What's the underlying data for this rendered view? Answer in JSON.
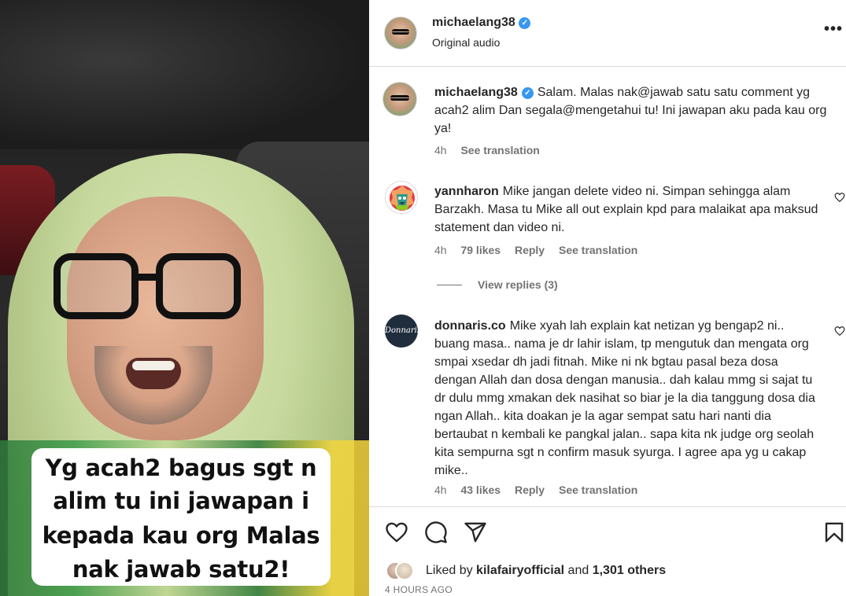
{
  "video": {
    "caption_lines": [
      "Yg acah2 bagus sgt n",
      "alim tu ini jawapan i",
      "kepada kau org Malas",
      "nak jawab satu2!"
    ]
  },
  "header": {
    "username": "michaelang38",
    "subtitle": "Original audio",
    "more_icon": "more-options-icon"
  },
  "caption": {
    "username": "michaelang38",
    "text": "Salam. Malas nak@jawab satu satu comment yg acah2 alim Dan segala@mengetahui tu! Ini jawapan aku pada kau org ya!",
    "time": "4h",
    "see_translation": "See translation"
  },
  "comments": [
    {
      "username": "yannharon",
      "text": "Mike jangan delete video ni. Simpan sehingga alam Barzakh. Masa tu Mike all out explain kpd para malaikat apa maksud statement dan video ni.",
      "time": "4h",
      "likes": "79 likes",
      "reply": "Reply",
      "see_translation": "See translation",
      "view_replies": "View replies (3)"
    },
    {
      "username": "donnaris.co",
      "avatar_text": "Donnaris",
      "text": "Mike xyah lah explain kat netizan yg bengap2 ni.. buang masa.. nama je dr lahir islam, tp mengutuk dan mengata org smpai xsedar dh jadi fitnah. Mike ni nk bgtau pasal beza dosa dengan Allah dan dosa dengan manusia.. dah kalau mmg si sajat tu dr dulu mmg xmakan dek nasihat so biar je la dia tanggung dosa dia ngan Allah.. kita doakan je la agar sempat satu hari nanti dia bertaubat n kembali ke pangkal jalan.. sapa kita nk judge org seolah kita sempurna sgt n confirm masuk syurga. I agree apa yg u cakap mike..",
      "time": "4h",
      "likes": "43 likes",
      "reply": "Reply",
      "see_translation": "See translation"
    }
  ],
  "footer": {
    "liked_by_prefix": "Liked by",
    "liked_by_user": "kilafairyofficial",
    "and": "and",
    "others": "1,301 others",
    "time_ago": "4 HOURS AGO"
  },
  "colors": {
    "verified": "#3897f0",
    "muted": "#737373",
    "text": "#262626"
  }
}
